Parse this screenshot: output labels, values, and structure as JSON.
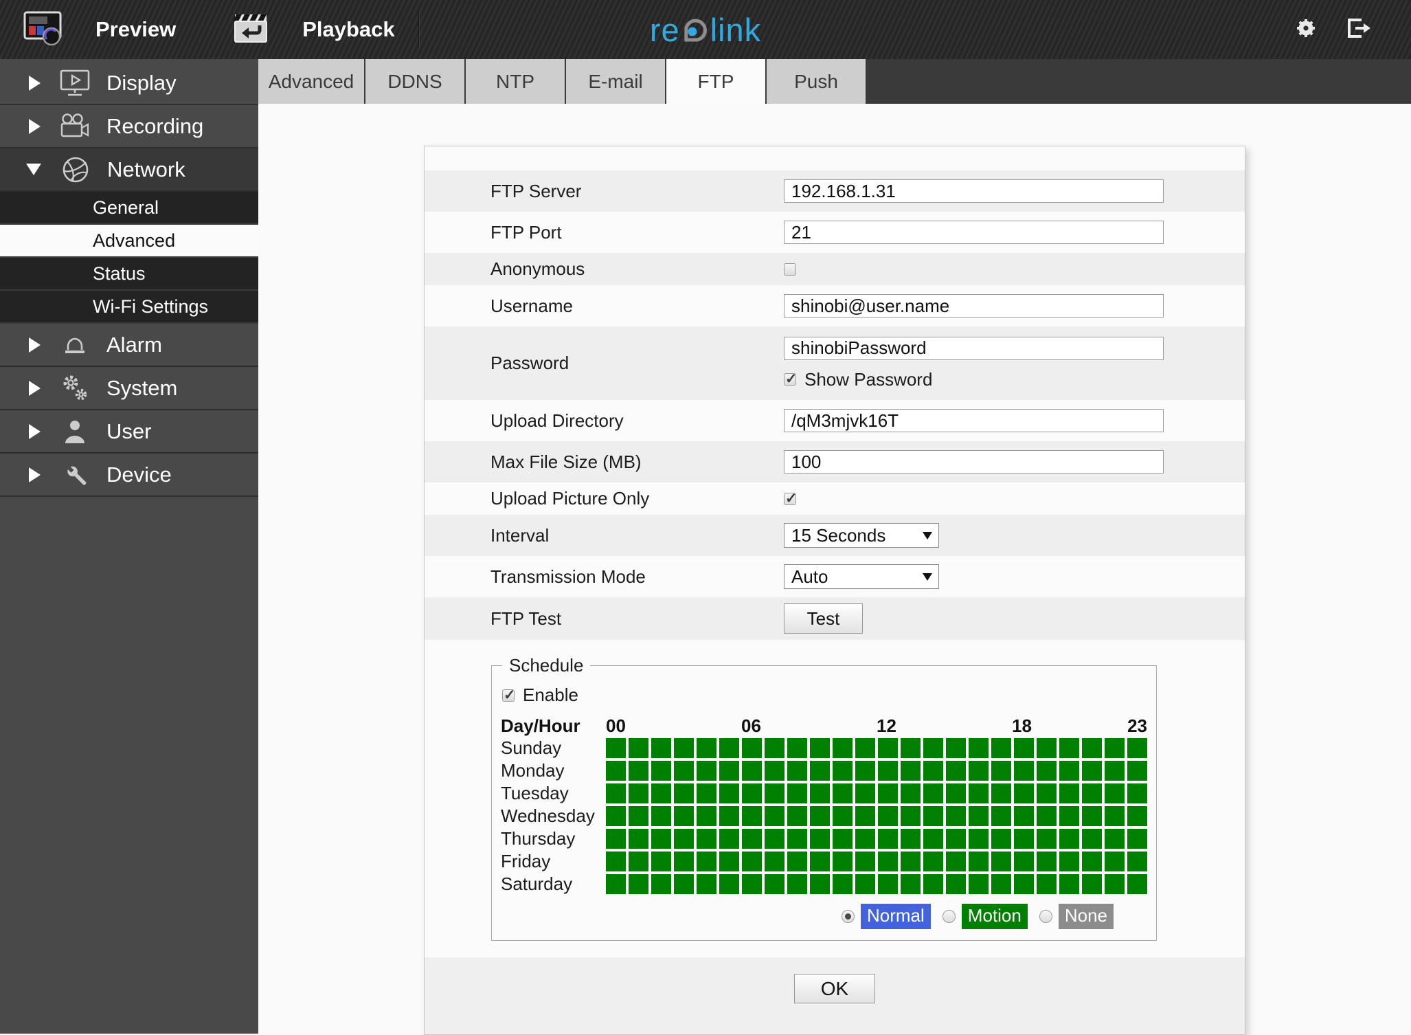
{
  "header": {
    "preview_label": "Preview",
    "playback_label": "Playback",
    "brand_re": "re",
    "brand_link": "link",
    "brand_color": "#2faae2"
  },
  "sidebar": {
    "items": [
      {
        "label": "Display"
      },
      {
        "label": "Recording"
      },
      {
        "label": "Network",
        "expanded": true,
        "children": [
          {
            "label": "General",
            "selected": false
          },
          {
            "label": "Advanced",
            "selected": true
          },
          {
            "label": "Status",
            "selected": false
          },
          {
            "label": "Wi-Fi Settings",
            "selected": false
          }
        ]
      },
      {
        "label": "Alarm"
      },
      {
        "label": "System"
      },
      {
        "label": "User"
      },
      {
        "label": "Device"
      }
    ]
  },
  "tabs": [
    {
      "label": "Advanced",
      "active": false
    },
    {
      "label": "DDNS",
      "active": false
    },
    {
      "label": "NTP",
      "active": false
    },
    {
      "label": "E-mail",
      "active": false
    },
    {
      "label": "FTP",
      "active": true
    },
    {
      "label": "Push",
      "active": false
    }
  ],
  "form": {
    "ftp_server": {
      "label": "FTP Server",
      "value": "192.168.1.31"
    },
    "ftp_port": {
      "label": "FTP Port",
      "value": "21"
    },
    "anonymous": {
      "label": "Anonymous",
      "checked": false
    },
    "username": {
      "label": "Username",
      "value": "shinobi@user.name"
    },
    "password": {
      "label": "Password",
      "value": "shinobiPassword",
      "show_label": "Show Password",
      "show_checked": true
    },
    "upload_directory": {
      "label": "Upload Directory",
      "value": "/qM3mjvk16T"
    },
    "max_file_size": {
      "label": "Max File Size (MB)",
      "value": "100"
    },
    "upload_picture_only": {
      "label": "Upload Picture Only",
      "checked": true
    },
    "interval": {
      "label": "Interval",
      "value": "15 Seconds"
    },
    "transmission_mode": {
      "label": "Transmission Mode",
      "value": "Auto"
    },
    "ftp_test": {
      "label": "FTP Test",
      "button_label": "Test"
    },
    "ok_label": "OK"
  },
  "schedule": {
    "legend": "Schedule",
    "enable_label": "Enable",
    "enable_checked": true,
    "corner_label": "Day/Hour",
    "hour_marks": [
      "00",
      "06",
      "12",
      "18",
      "23"
    ],
    "days": [
      "Sunday",
      "Monday",
      "Tuesday",
      "Wednesday",
      "Thursday",
      "Friday",
      "Saturday"
    ],
    "hours_per_day": 24,
    "all_cells_on": true,
    "cell_on_color": "#008000",
    "modes": [
      {
        "label": "Normal",
        "color": "#4263dd",
        "selected": true
      },
      {
        "label": "Motion",
        "color": "#008000",
        "selected": false
      },
      {
        "label": "None",
        "color": "#8c8c8c",
        "selected": false
      }
    ]
  }
}
